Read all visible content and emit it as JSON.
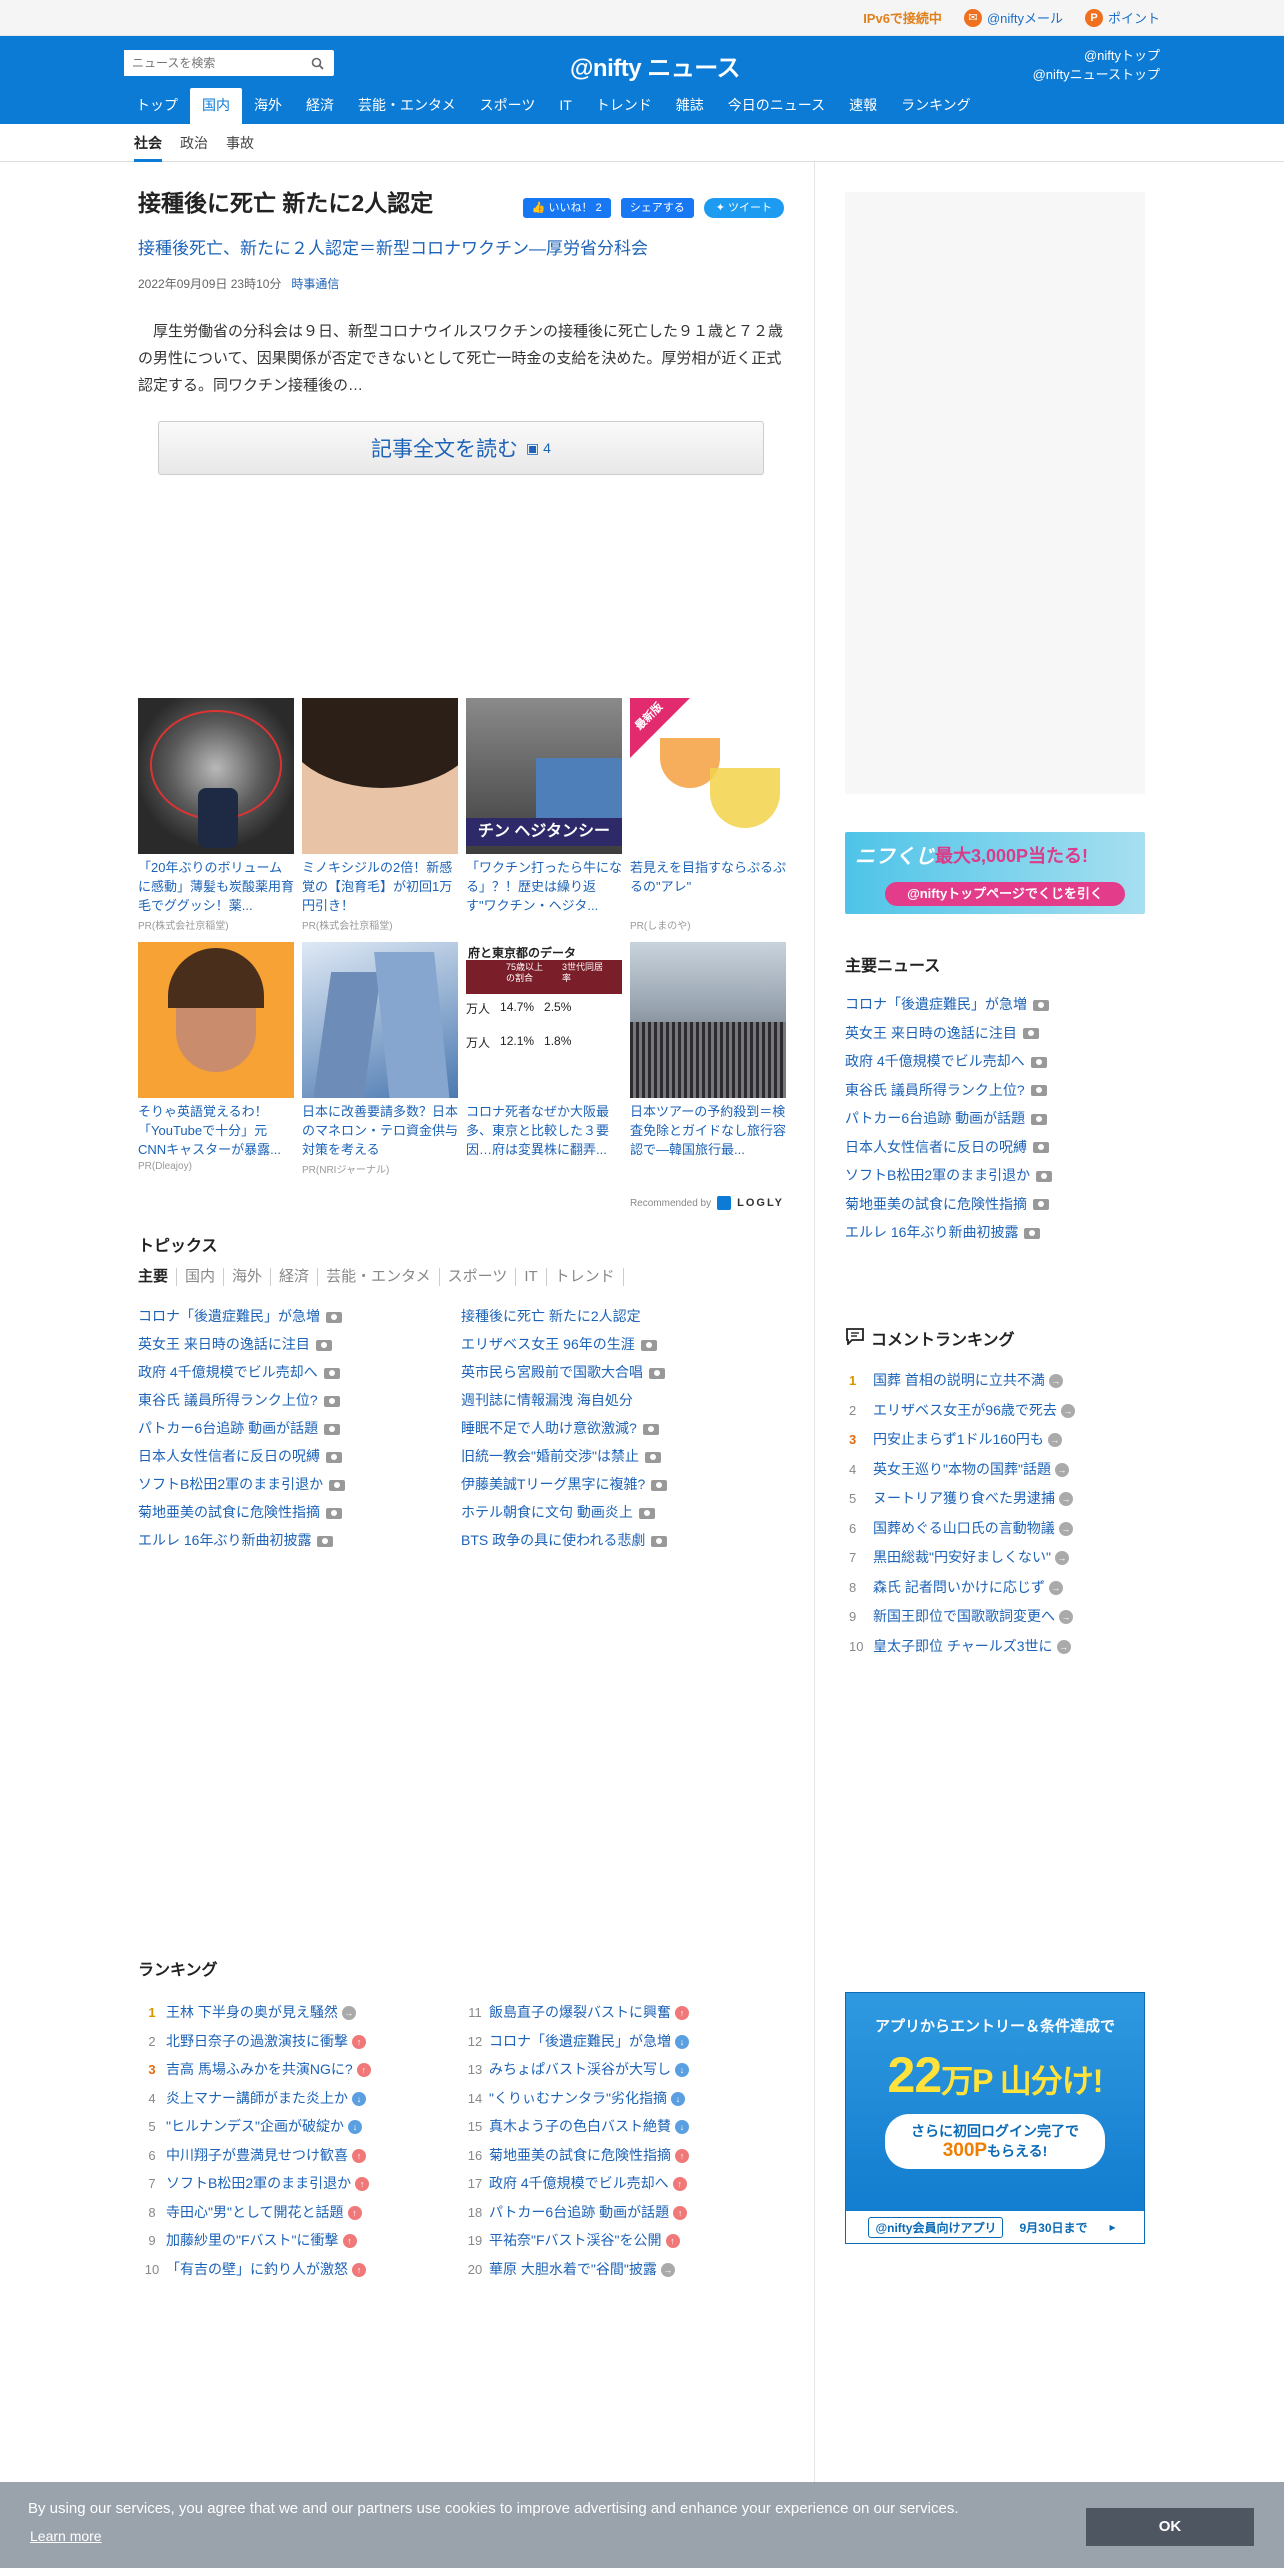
{
  "topbar": {
    "ipv6": "IPv6で接続中",
    "mail": "@niftyメール",
    "point": "ポイント"
  },
  "header": {
    "search_placeholder": "ニュースを検索",
    "logo": "@nifty ニュース",
    "link1": "@niftyトップ",
    "link2": "@niftyニューストップ"
  },
  "nav": [
    "トップ",
    "国内",
    "海外",
    "経済",
    "芸能・エンタメ",
    "スポーツ",
    "IT",
    "トレンド",
    "雑誌",
    "今日のニュース",
    "速報",
    "ランキング"
  ],
  "subnav": [
    "社会",
    "政治",
    "事故"
  ],
  "article": {
    "title": "接種後に死亡 新たに2人認定",
    "like": "いいね！ 2",
    "share": "シェアする",
    "tweet": "ツイート",
    "subtitle": "接種後死亡、新たに２人認定＝新型コロナワクチン―厚労省分科会",
    "date": "2022年09月09日 23時10分",
    "source": "時事通信",
    "body": "厚生労働省の分科会は９日、新型コロナウイルスワクチンの接種後に死亡した９１歳と７２歳の男性について、因果関係が否定できないとして死亡一時金の支給を決めた。厚労相が近く正式認定する。同ワクチン接種後の…",
    "read_more": "記事全文を読む",
    "photos": "4"
  },
  "ads": [
    {
      "title": "「20年ぶりのボリュームに感動」薄髪も炭酸薬用育毛でググッシ！薬...",
      "pr": "PR(株式会社京稲堂)"
    },
    {
      "title": "ミノキシジルの2倍！新感覚の【泡育毛】が初回1万円引き！",
      "pr": "PR(株式会社京稲堂)"
    },
    {
      "title": "「ワクチン打ったら牛になる」？！歴史は繰り返す\"ワクチン・ヘジタ...",
      "pr": ""
    },
    {
      "title": "若見えを目指すならぷるぷるの\"アレ\"",
      "pr": "PR(しまのや)"
    },
    {
      "title": "そりゃ英語覚えるわ！「YouTubeで十分」元CNNキャスターが暴露...",
      "pr": "PR(Dleajoy)"
    },
    {
      "title": "日本に改善要請多数？日本のマネロン・テロ資金供与対策を考える",
      "pr": "PR(NRIジャーナル)"
    },
    {
      "title": "コロナ死者なぜか大阪最多、東京と比較した３要因…府は変異株に翻弄...",
      "pr": ""
    },
    {
      "title": "日本ツアーの予約殺到＝検査免除とガイドなし旅行容認で―韓国旅行最...",
      "pr": ""
    }
  ],
  "ad_badge": "最新版",
  "ad_img3_text": "チン ヘジタンシー",
  "ad_img7": {
    "head": "府と東京都のデータ",
    "c1": "75歳以上の割合",
    "c2": "3世代同居率",
    "r1": [
      "万人",
      "14.7%",
      "2.5%"
    ],
    "r2": [
      "万人",
      "12.1%",
      "1.8%"
    ]
  },
  "recommended": "Recommended by",
  "logly": "LOGLY",
  "topics": {
    "title": "トピックス",
    "tabs": [
      "主要",
      "国内",
      "海外",
      "経済",
      "芸能・エンタメ",
      "スポーツ",
      "IT",
      "トレンド"
    ],
    "left": [
      "コロナ「後遺症難民」が急増",
      "英女王 来日時の逸話に注目",
      "政府 4千億規模でビル売却へ",
      "東谷氏 議員所得ランク上位?",
      "パトカー6台追跡 動画が話題",
      "日本人女性信者に反日の呪縛",
      "ソフトB松田2軍のまま引退か",
      "菊地亜美の試食に危険性指摘",
      "エルレ 16年ぶり新曲初披露"
    ],
    "right": [
      "接種後に死亡 新たに2人認定",
      "エリザベス女王 96年の生涯",
      "英市民ら宮殿前で国歌大合唱",
      "週刊誌に情報漏洩 海自処分",
      "睡眠不足で人助け意欲激減?",
      "旧統一教会\"婚前交渉\"は禁止",
      "伊藤美誠Tリーグ黒字に複雑?",
      "ホテル朝食に文句 動画炎上",
      "BTS 政争の具に使われる悲劇"
    ]
  },
  "ranking": {
    "title": "ランキング",
    "left": [
      [
        "1",
        "王林 下半身の奥が見え騒然",
        "st"
      ],
      [
        "2",
        "北野日奈子の過激演技に衝撃",
        "up"
      ],
      [
        "3",
        "吉高 馬場ふみかを共演NGに?",
        "up"
      ],
      [
        "4",
        "炎上マナー講師がまた炎上か",
        "dn"
      ],
      [
        "5",
        "\"ヒルナンデス\"企画が破綻か",
        "dn"
      ],
      [
        "6",
        "中川翔子が豊満見せつけ歓喜",
        "up"
      ],
      [
        "7",
        "ソフトB松田2軍のまま引退か",
        "up"
      ],
      [
        "8",
        "寺田心\"男\"として開花と話題",
        "up"
      ],
      [
        "9",
        "加藤紗里の\"Fバスト\"に衝撃",
        "up"
      ],
      [
        "10",
        "「有吉の壁」に釣り人が激怒",
        "up"
      ]
    ],
    "right": [
      [
        "11",
        "飯島直子の爆裂バストに興奮",
        "up"
      ],
      [
        "12",
        "コロナ「後遺症難民」が急増",
        "dn"
      ],
      [
        "13",
        "みちょぱバスト渓谷が大写し",
        "dn"
      ],
      [
        "14",
        "\"くりぃむナンタラ\"劣化指摘",
        "dn"
      ],
      [
        "15",
        "真木よう子の色白バスト絶賛",
        "dn"
      ],
      [
        "16",
        "菊地亜美の試食に危険性指摘",
        "up"
      ],
      [
        "17",
        "政府 4千億規模でビル売却へ",
        "up"
      ],
      [
        "18",
        "パトカー6台追跡 動画が話題",
        "up"
      ],
      [
        "19",
        "平祐奈\"Fバスト渓谷\"を公開",
        "up"
      ],
      [
        "20",
        "華原 大胆水着で\"谷間\"披露",
        "st"
      ]
    ]
  },
  "side": {
    "kuji_logo": "ニフくじ",
    "kuji_prize": "最大3,000P当たる!",
    "kuji_cta": "@niftyトップページでくじを引く",
    "main_news_title": "主要ニュース",
    "main_news": [
      "コロナ「後遺症難民」が急増",
      "英女王 来日時の逸話に注目",
      "政府 4千億規模でビル売却へ",
      "東谷氏 議員所得ランク上位?",
      "パトカー6台追跡 動画が話題",
      "日本人女性信者に反日の呪縛",
      "ソフトB松田2軍のまま引退か",
      "菊地亜美の試食に危険性指摘",
      "エルレ 16年ぶり新曲初披露"
    ],
    "comment_title": "コメントランキング",
    "comment": [
      [
        "1",
        "国葬 首相の説明に立共不満"
      ],
      [
        "2",
        "エリザベス女王が96歳で死去"
      ],
      [
        "3",
        "円安止まらず1ドル160円も"
      ],
      [
        "4",
        "英女王巡り\"本物の国葬\"話題"
      ],
      [
        "5",
        "ヌートリア獲り食べた男逮捕"
      ],
      [
        "6",
        "国葬めぐる山口氏の言動物議"
      ],
      [
        "7",
        "黒田総裁\"円安好ましくない\""
      ],
      [
        "8",
        "森氏 記者問いかけに応じず"
      ],
      [
        "9",
        "新国王即位で国歌歌詞変更へ"
      ],
      [
        "10",
        "皇太子即位 チャールズ3世に"
      ]
    ],
    "app_line1": "アプリからエントリー＆条件達成で",
    "app_num": "22",
    "app_unit": "万P 山分け!",
    "app_line3": "さらに初回ログイン完了で",
    "app_300": "300P",
    "app_line4": "もらえる!",
    "app_badge": "@nifty会員向けアプリ",
    "app_date": "9月30日まで"
  },
  "cookie": {
    "text": "By using our services, you agree that we and our partners use cookies to improve advertising and enhance your experience on our services.",
    "learn": "Learn more",
    "ok": "OK"
  },
  "colors": {
    "brand": "#0b7bd6",
    "link": "#1d63b7",
    "accent": "#e0801a"
  }
}
